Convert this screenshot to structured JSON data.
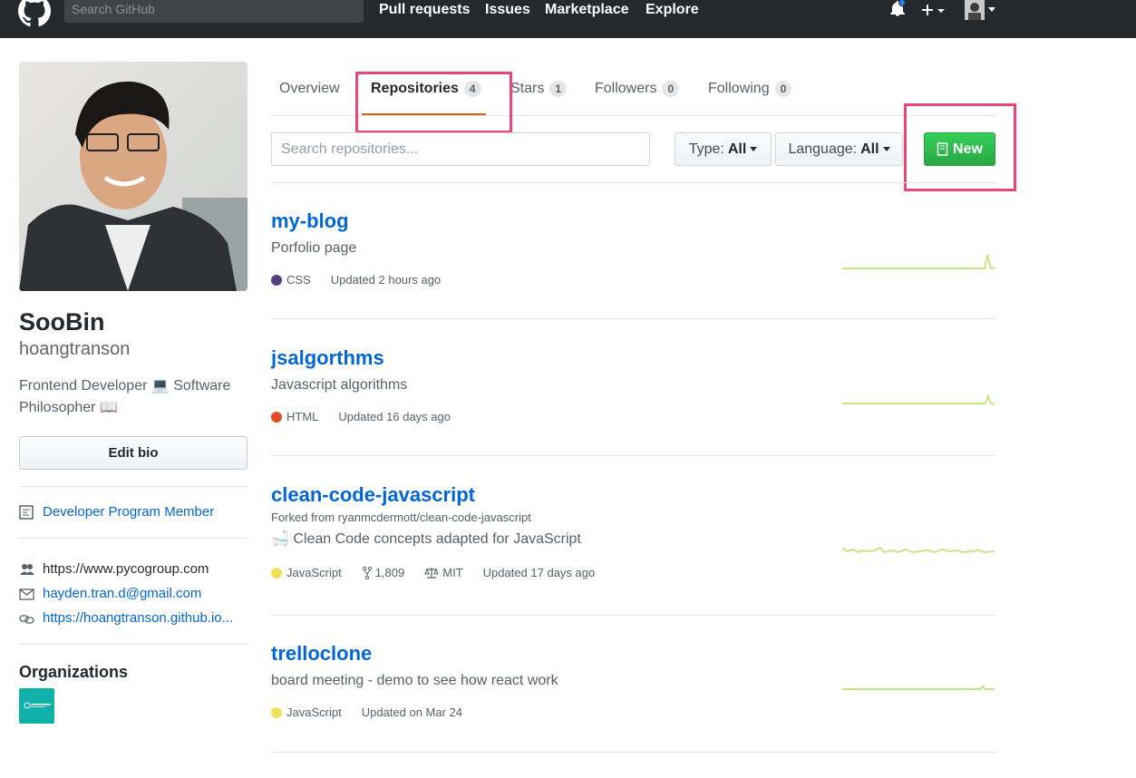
{
  "header": {
    "search_placeholder": "Search GitHub",
    "nav": [
      "Pull requests",
      "Issues",
      "Marketplace",
      "Explore"
    ],
    "icons": [
      "github-logo",
      "bell-icon",
      "plus-icon",
      "avatar-icon"
    ]
  },
  "profile": {
    "full_name": "SooBin",
    "username": "hoangtranson",
    "bio_line1": "Frontend Developer 💻  Software",
    "bio_line2": "Philosopher 📖",
    "edit_bio": "Edit bio",
    "badge": "Developer Program Member",
    "company": "https://www.pycogroup.com",
    "email": "hayden.tran.d@gmail.com",
    "website": "https://hoangtranson.github.io...",
    "organizations_title": "Organizations"
  },
  "tabs": [
    {
      "label": "Overview",
      "count": ""
    },
    {
      "label": "Repositories",
      "count": "4"
    },
    {
      "label": "Stars",
      "count": "1"
    },
    {
      "label": "Followers",
      "count": "0"
    },
    {
      "label": "Following",
      "count": "0"
    }
  ],
  "filters": {
    "search_placeholder": "Search repositories...",
    "type_label": "Type:",
    "type_value": "All",
    "language_label": "Language:",
    "language_value": "All",
    "new_button": "New"
  },
  "repos": [
    {
      "name": "my-blog",
      "fork": "",
      "description": "Porfolio page",
      "language": "CSS",
      "lang_color": "#563d7c",
      "forks": "",
      "license": "",
      "updated": "Updated 2 hours ago"
    },
    {
      "name": "jsalgorthms",
      "fork": "",
      "description": "Javascript algorithms",
      "language": "HTML",
      "lang_color": "#e34c26",
      "forks": "",
      "license": "",
      "updated": "Updated 16 days ago"
    },
    {
      "name": "clean-code-javascript",
      "fork": "Forked from ryanmcdermott/clean-code-javascript",
      "description": "🛁 Clean Code concepts adapted for JavaScript",
      "language": "JavaScript",
      "lang_color": "#f1e05a",
      "forks": "1,809",
      "license": "MIT",
      "updated": "Updated 17 days ago"
    },
    {
      "name": "trelloclone",
      "fork": "",
      "description": "board meeting - demo to see how react work",
      "language": "JavaScript",
      "lang_color": "#f1e05a",
      "forks": "",
      "license": "",
      "updated": "Updated on Mar 24"
    }
  ],
  "colors": {
    "accent_tab": "#e36209",
    "highlight": "#e8467c",
    "link": "#0366d6",
    "new_button": "#28a745"
  }
}
